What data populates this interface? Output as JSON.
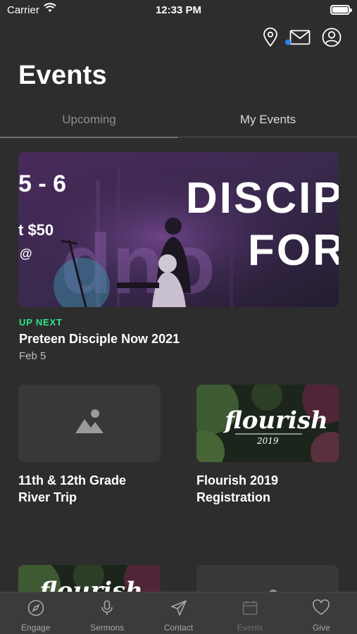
{
  "status_bar": {
    "carrier": "Carrier",
    "time": "12:33 PM"
  },
  "header": {
    "title": "Events",
    "icons": [
      "location-pin-icon",
      "mail-icon",
      "account-icon"
    ],
    "mail_unread": true
  },
  "tabs": [
    {
      "label": "Upcoming",
      "selected": true
    },
    {
      "label": "My Events",
      "selected": false
    }
  ],
  "featured": {
    "badge": "UP NEXT",
    "title": "Preteen Disciple Now 2021",
    "date": "Feb 5",
    "image_text": {
      "dates": "5 - 6",
      "price": "t $50",
      "at": "@",
      "line1": "DISCIP",
      "line2": "FOR"
    }
  },
  "events": [
    {
      "title": "11th & 12th Grade River Trip",
      "image": "placeholder"
    },
    {
      "title": "Flourish 2019 Registration",
      "image": "flourish",
      "image_text": {
        "script": "flourish",
        "year": "2019"
      }
    },
    {
      "title": "",
      "image": "flourish",
      "image_text": {
        "script": "flourish"
      }
    },
    {
      "title": "",
      "image": "placeholder"
    }
  ],
  "tab_bar": [
    {
      "label": "Engage",
      "icon": "compass-icon"
    },
    {
      "label": "Sermons",
      "icon": "microphone-icon"
    },
    {
      "label": "Contact",
      "icon": "paper-plane-icon"
    },
    {
      "label": "Events",
      "icon": "calendar-icon",
      "active": true
    },
    {
      "label": "Give",
      "icon": "heart-icon"
    }
  ],
  "colors": {
    "background": "#2d2d2d",
    "accent_green": "#2ee58b",
    "mail_dot": "#2f7ef6",
    "tab_bar": "#3b3b3b"
  }
}
